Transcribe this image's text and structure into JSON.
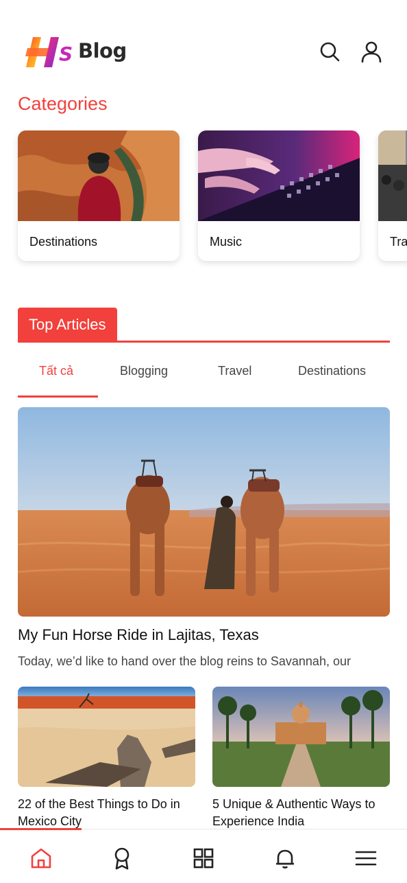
{
  "header": {
    "logo_text": "Blog",
    "logo_letters": "HS"
  },
  "categories": {
    "title": "Categories",
    "items": [
      {
        "label": "Destinations",
        "image": "canyon-traveler"
      },
      {
        "label": "Music",
        "image": "dj-mixer"
      },
      {
        "label": "Tra",
        "image": "street-crowd"
      }
    ]
  },
  "top_articles": {
    "title": "Top Articles",
    "tabs": [
      "Tất cả",
      "Blogging",
      "Travel",
      "Destinations"
    ],
    "active_tab": "Tất cả"
  },
  "featured": {
    "title": "My Fun Horse Ride in Lajitas, Texas",
    "excerpt": "Today, we’d like to hand over the blog reins to Savannah, our",
    "image": "camels-desert"
  },
  "articles": [
    {
      "title": "22 of the Best Things to Do in Mexico City",
      "image": "desert-deadwood"
    },
    {
      "title": "5 Unique & Authentic Ways to Experience India",
      "image": "india-palace"
    }
  ],
  "bottom_nav": [
    "home-icon",
    "award-icon",
    "grid-icon",
    "bell-icon",
    "menu-icon"
  ],
  "colors": {
    "accent": "#f2403c",
    "text": "#111111"
  }
}
